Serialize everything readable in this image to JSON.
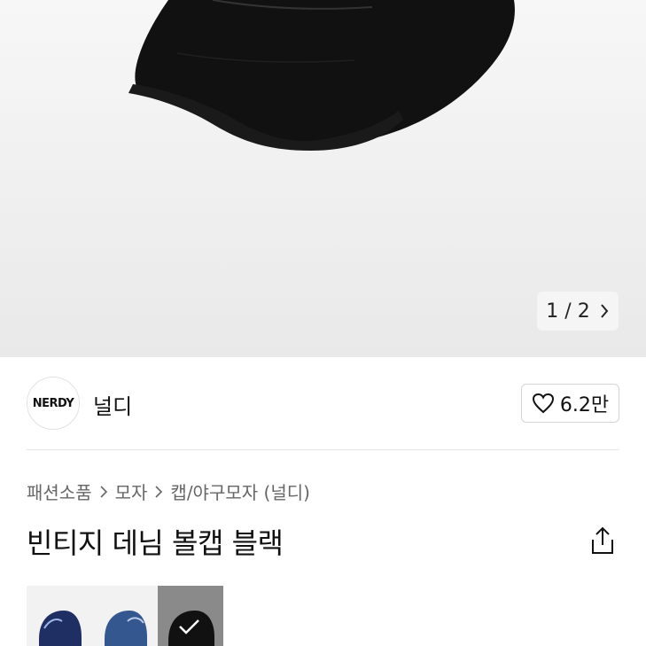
{
  "hero": {
    "pager": {
      "current": "1",
      "separator": "/",
      "total": "2"
    }
  },
  "brand": {
    "logo_text": "NERDY",
    "name": "널디",
    "likes": "6.2만"
  },
  "breadcrumb": [
    "패션소품",
    "모자",
    "캡/야구모자 (널디)"
  ],
  "product": {
    "title": "빈티지 데님 볼캡 블랙"
  },
  "variants": [
    {
      "color": "navy",
      "selected": false
    },
    {
      "color": "blue",
      "selected": false
    },
    {
      "color": "black",
      "selected": true
    }
  ]
}
